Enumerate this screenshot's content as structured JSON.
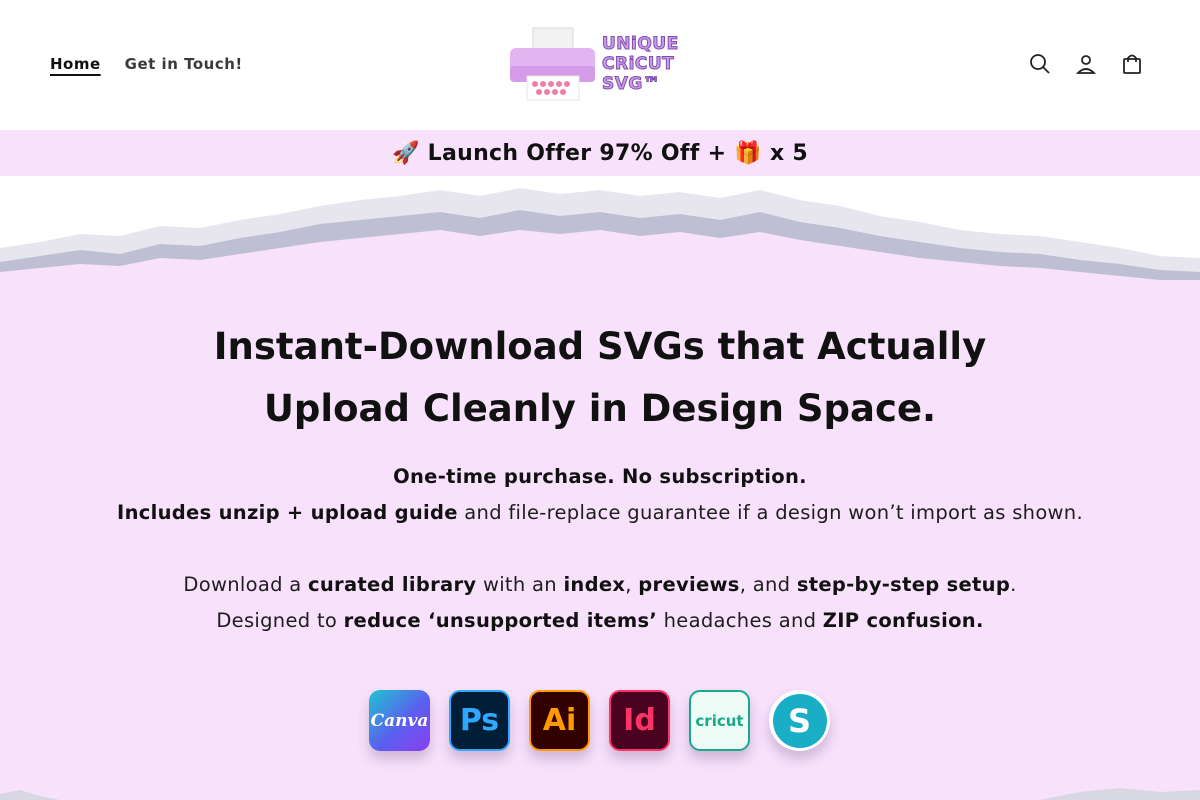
{
  "nav": {
    "items": [
      {
        "label": "Home",
        "active": true
      },
      {
        "label": "Get in Touch!",
        "active": false
      }
    ]
  },
  "logo": {
    "line1": "UNiQUE",
    "line2": "CRiCUT",
    "line3": "SVG™"
  },
  "header_icons": [
    "search-icon",
    "account-icon",
    "cart-icon"
  ],
  "announcement": {
    "text": "🚀 Launch Offer 97% Off + 🎁 x 5"
  },
  "hero": {
    "headline_line1": "Instant-Download SVGs that Actually",
    "headline_line2": "Upload Cleanly in Design Space.",
    "p1_bold": "One-time purchase. No subscription.",
    "p2_bold": "Includes unzip + upload guide",
    "p2_rest": " and file-replace guarantee if a design won’t import as shown.",
    "p3_a": "Download a ",
    "p3_b": "curated library",
    "p3_c": " with an ",
    "p3_d": "index",
    "p3_e": ", ",
    "p3_f": "previews",
    "p3_g": ", and ",
    "p3_h": "step-by-step setup",
    "p3_i": ".",
    "p4_a": "Designed to ",
    "p4_b": "reduce ‘unsupported items’",
    "p4_c": " headaches and ",
    "p4_d": "ZIP confusion."
  },
  "apps": [
    {
      "name": "canva-icon",
      "label": "Canva"
    },
    {
      "name": "photoshop-icon",
      "label": "Ps"
    },
    {
      "name": "illustrator-icon",
      "label": "Ai"
    },
    {
      "name": "indesign-icon",
      "label": "Id"
    },
    {
      "name": "cricut-icon",
      "label": "cricut"
    },
    {
      "name": "silhouette-icon",
      "label": "S"
    }
  ],
  "colors": {
    "pink_bg": "#f8e1fb",
    "logo_purple": "#c99be8"
  }
}
